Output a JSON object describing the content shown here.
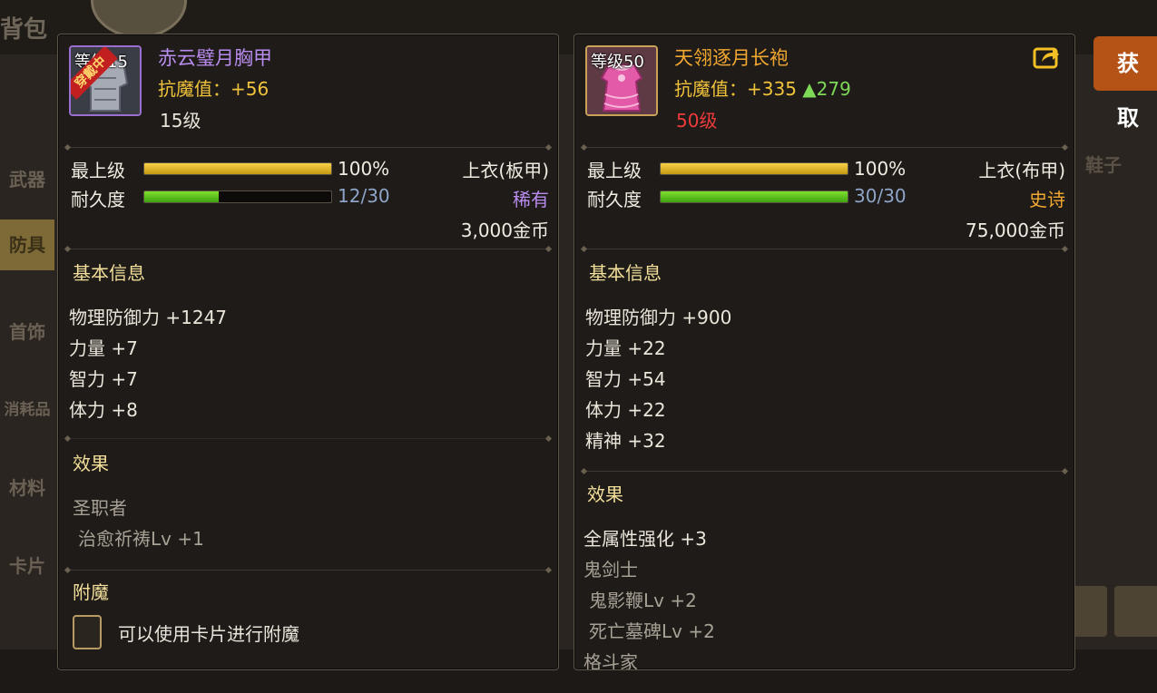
{
  "background": {
    "title": "背包",
    "sidebar": [
      "武器",
      "防具",
      "首饰",
      "消耗品",
      "材料",
      "卡片"
    ],
    "active_tab": "防具",
    "right_button": "获取",
    "right_label": "鞋子"
  },
  "left_item": {
    "thumb_level": "等级15",
    "equipped_badge": "穿戴中",
    "name": "赤云璧月胸甲",
    "resist_label": "抗魔值：",
    "resist_value": "+56",
    "level": "15级",
    "max_level_label": "最上级",
    "max_level_value": "100%",
    "max_level_fraction": 1.0,
    "durability_label": "耐久度",
    "durability_value": "12/30",
    "durability_fraction": 0.4,
    "slot": "上衣(板甲)",
    "rarity": "稀有",
    "price": "3,000金币",
    "basic_info_title": "基本信息",
    "stats": [
      "物理防御力 +1247",
      "力量 +7",
      "智力 +7",
      "体力 +8"
    ],
    "effect_title": "效果",
    "effect_class": "圣职者",
    "effect_skill": "治愈祈祷Lv +1",
    "enchant_title": "附魔",
    "enchant_text": "可以使用卡片进行附魔"
  },
  "right_item": {
    "thumb_level": "等级50",
    "name": "天翎逐月长袍",
    "resist_label": "抗魔值：",
    "resist_value": "+335",
    "resist_delta": "▲279",
    "level": "50级",
    "max_level_label": "最上级",
    "max_level_value": "100%",
    "max_level_fraction": 1.0,
    "durability_label": "耐久度",
    "durability_value": "30/30",
    "durability_fraction": 1.0,
    "slot": "上衣(布甲)",
    "rarity": "史诗",
    "price": "75,000金币",
    "basic_info_title": "基本信息",
    "stats": [
      "物理防御力 +900",
      "力量 +22",
      "智力 +54",
      "体力 +22",
      "精神 +32"
    ],
    "effect_title": "效果",
    "effect_all": "全属性强化 +3",
    "effect_class": "鬼剑士",
    "effect_skills": [
      "鬼影鞭Lv +2",
      "死亡墓碑Lv +2"
    ],
    "effect_class_2": "格斗家"
  },
  "colors": {
    "rare": "#b98cf0",
    "epic": "#f2a731",
    "resist": "#f1c33c",
    "increase": "#7ed957",
    "level_warning": "#ee3b3b"
  }
}
